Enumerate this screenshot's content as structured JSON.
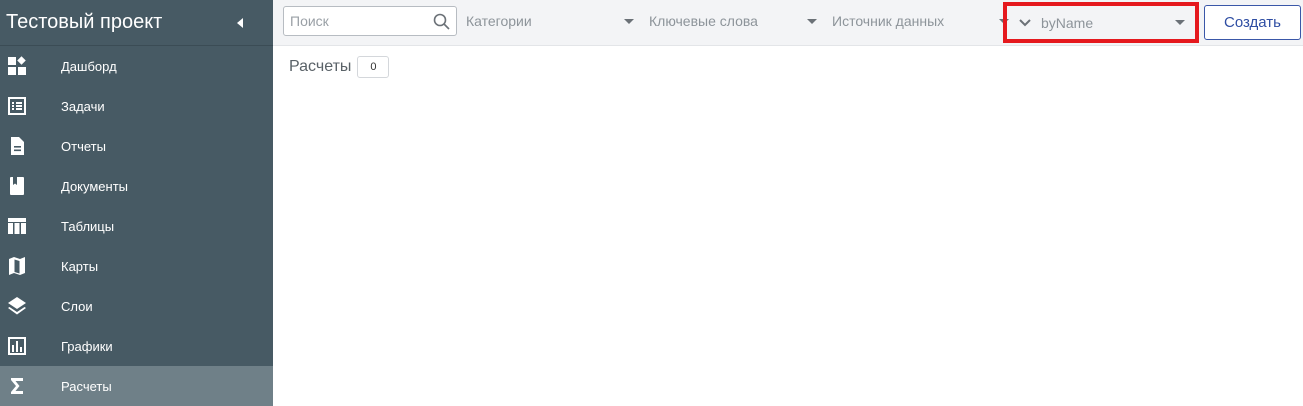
{
  "sidebar": {
    "project_title": "Тестовый проект",
    "items": [
      {
        "label": "Дашборд",
        "icon": "dashboard-icon"
      },
      {
        "label": "Задачи",
        "icon": "tasks-list-icon"
      },
      {
        "label": "Отчеты",
        "icon": "document-icon"
      },
      {
        "label": "Документы",
        "icon": "book-icon"
      },
      {
        "label": "Таблицы",
        "icon": "table-icon"
      },
      {
        "label": "Карты",
        "icon": "map-icon"
      },
      {
        "label": "Слои",
        "icon": "layers-icon"
      },
      {
        "label": "Графики",
        "icon": "bar-chart-icon"
      },
      {
        "label": "Расчеты",
        "icon": "sigma-icon",
        "active": true
      }
    ]
  },
  "toolbar": {
    "search": {
      "placeholder": "Поиск",
      "value": ""
    },
    "filters": {
      "categories": "Категории",
      "keywords": "Ключевые слова",
      "source": "Источник данных"
    },
    "sort": {
      "value": "byName"
    },
    "create_label": "Создать"
  },
  "content": {
    "title": "Расчеты",
    "count": "0"
  },
  "colors": {
    "sidebar_bg": "#475a64",
    "active_item_bg": "#6f8088",
    "highlight_border": "#e5191e",
    "accent": "#2f4ea3"
  }
}
